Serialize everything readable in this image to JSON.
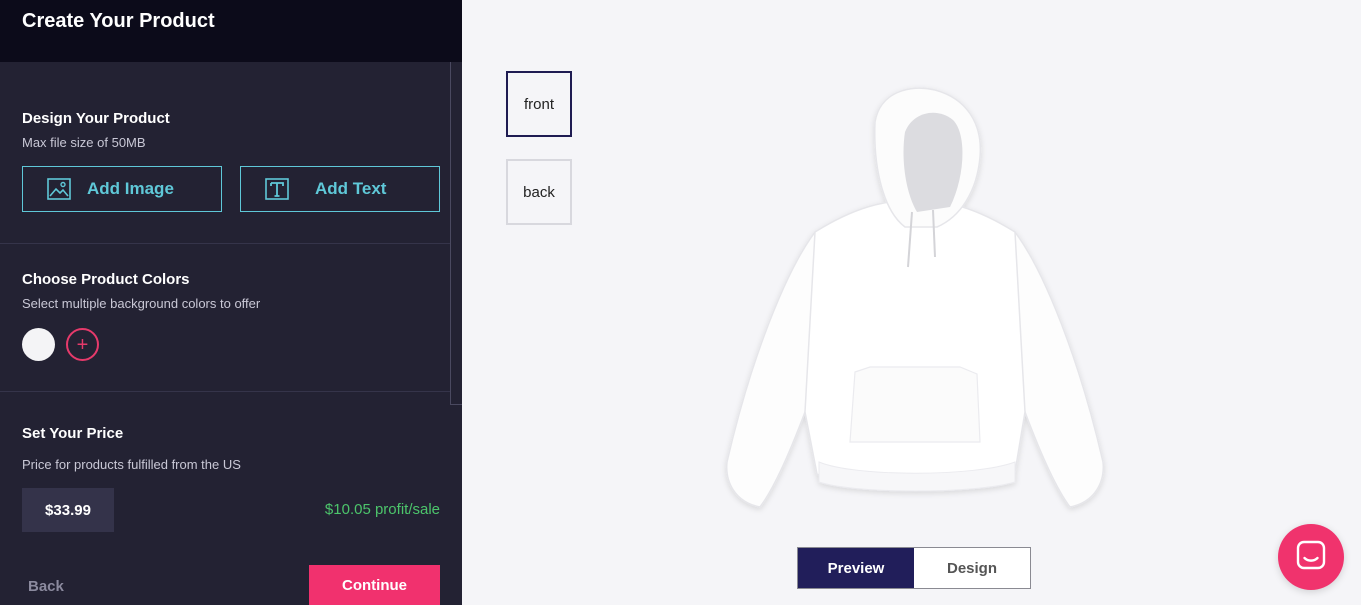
{
  "header": {
    "title": "Create Your Product"
  },
  "design": {
    "title": "Design Your Product",
    "subtitle": "Max file size of 50MB",
    "add_image_label": "Add Image",
    "add_text_label": "Add Text"
  },
  "colors": {
    "title": "Choose Product Colors",
    "subtitle": "Select multiple background colors to offer",
    "swatches": [
      "#f4f4f6"
    ],
    "add_symbol": "+"
  },
  "price": {
    "title": "Set Your Price",
    "subtitle": "Price for products fulfilled from the US",
    "value": "$33.99",
    "profit": "$10.05 profit/sale"
  },
  "footer": {
    "back_label": "Back",
    "continue_label": "Continue"
  },
  "views": {
    "front_label": "front",
    "back_label": "back"
  },
  "toggle": {
    "preview_label": "Preview",
    "design_label": "Design"
  },
  "theme": {
    "accent": "#f1316e",
    "teal": "#5fc8d8",
    "navy": "#211e5a",
    "profit_green": "#4cc46b"
  }
}
